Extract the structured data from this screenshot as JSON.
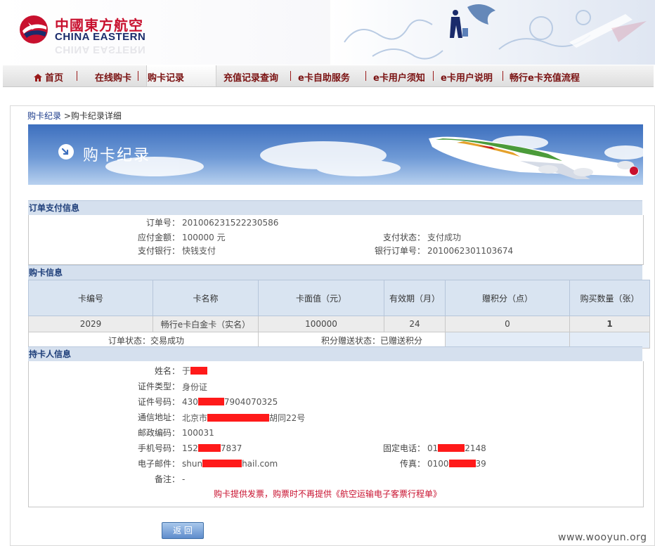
{
  "brand": {
    "name_cn": "中國東方航空",
    "name_en": "CHINA EASTERN",
    "red": "#c8102e",
    "navy": "#1a2b6b"
  },
  "nav": {
    "items": [
      {
        "label": "首页",
        "icon": "home-icon"
      },
      {
        "label": "在线购卡"
      },
      {
        "label": "购卡记录",
        "active": true
      },
      {
        "label": "充值记录查询"
      },
      {
        "label": "e卡自助服务"
      },
      {
        "label": "e卡用户须知"
      },
      {
        "label": "e卡用户说明"
      },
      {
        "label": "畅行e卡充值流程"
      }
    ]
  },
  "breadcrumb": {
    "root": "购卡纪录",
    "separator": " >",
    "current": "购卡纪录详细"
  },
  "banner": {
    "title": "购卡纪录",
    "icon": "arrow-circle-icon"
  },
  "order": {
    "section_title": "订单支付信息",
    "order_no_label": "订单号：",
    "order_no": "201006231522230586",
    "amount_label": "应付金额：",
    "amount": "100000 元",
    "pay_status_label": "支付状态：",
    "pay_status": "支付成功",
    "pay_bank_label": "支付银行：",
    "pay_bank": "快钱支付",
    "bank_order_label": "银行订单号：",
    "bank_order": "2010062301103674"
  },
  "card": {
    "section_title": "购卡信息",
    "columns": [
      "卡编号",
      "卡名称",
      "卡面值（元）",
      "有效期（月）",
      "赠积分（点）",
      "购买数量（张）"
    ],
    "row": [
      "2029",
      "畅行e卡白金卡（实名）",
      "100000",
      "24",
      "0",
      "1"
    ],
    "order_status_label": "订单状态：",
    "order_status": "交易成功",
    "points_status_label": "积分赠送状态：",
    "points_status": "已赠送积分"
  },
  "holder": {
    "section_title": "持卡人信息",
    "name_label": "姓名：",
    "name": "于",
    "id_type_label": "证件类型：",
    "id_type": "身份证",
    "id_no_label": "证件号码：",
    "id_no_a": "430",
    "id_no_b": "7904070325",
    "address_label": "通信地址：",
    "address_a": "北京市",
    "address_b": "胡同22号",
    "zip_label": "邮政编码：",
    "zip": "100031",
    "mobile_label": "手机号码：",
    "mobile_a": "152",
    "mobile_b": "7837",
    "phone_label": "固定电话：",
    "phone_a": "01",
    "phone_b": "2148",
    "email_label": "电子邮件：",
    "email_a": "shun",
    "email_b": "hail.com",
    "fax_label": "传真：",
    "fax_a": "0100",
    "fax_b": "39",
    "remark_label": "备注：",
    "remark": "-"
  },
  "notice": "购卡提供发票，购票时不再提供《航空运输电子客票行程单》",
  "back_button": "返  回",
  "watermark": "www.wooyun.org"
}
